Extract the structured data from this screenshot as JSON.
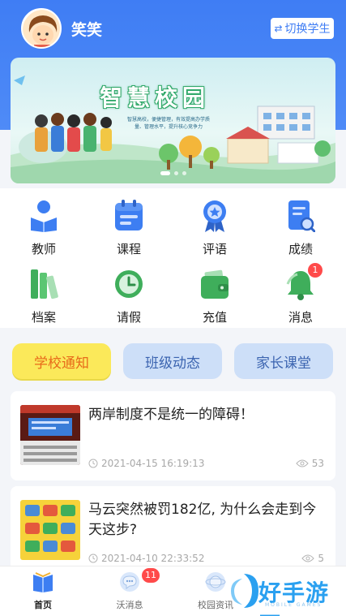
{
  "header": {
    "username": "笑笑",
    "switch_label": "切换学生",
    "switch_icon": "swap-icon"
  },
  "banner": {
    "title": "智慧校园",
    "subtitle": "智慧高校，便捷管理，有效提高办学质量、管理水平，提升核心竞争力"
  },
  "grid": [
    {
      "label": "教师",
      "icon": "teacher-icon"
    },
    {
      "label": "课程",
      "icon": "calendar-icon"
    },
    {
      "label": "评语",
      "icon": "medal-icon"
    },
    {
      "label": "成绩",
      "icon": "report-search-icon"
    },
    {
      "label": "档案",
      "icon": "books-icon"
    },
    {
      "label": "请假",
      "icon": "clock-icon"
    },
    {
      "label": "充值",
      "icon": "wallet-icon"
    },
    {
      "label": "消息",
      "icon": "bell-icon",
      "badge": "1"
    }
  ],
  "tabs": [
    {
      "label": "学校通知"
    },
    {
      "label": "班级动态"
    },
    {
      "label": "家长课堂"
    }
  ],
  "news": [
    {
      "title": "两岸制度不是统一的障碍！",
      "time": "2021-04-15 16:19:13",
      "views": "53"
    },
    {
      "title": "马云突然被罚182亿, 为什么会走到今天这步?",
      "time": "2021-04-10 22:33:52",
      "views": "5"
    }
  ],
  "bottom_nav": [
    {
      "label": "首页",
      "icon": "home-book-icon"
    },
    {
      "label": "沃消息",
      "icon": "chat-bubble-icon",
      "badge": "11"
    },
    {
      "label": "校园资讯",
      "icon": "globe-icon"
    }
  ],
  "watermark": {
    "text": "好手游网",
    "sub": "MOBILE GAMES"
  },
  "colors": {
    "primary": "#3f7df4",
    "accent_yellow": "#fbe95a",
    "badge_red": "#ff4a4a"
  }
}
